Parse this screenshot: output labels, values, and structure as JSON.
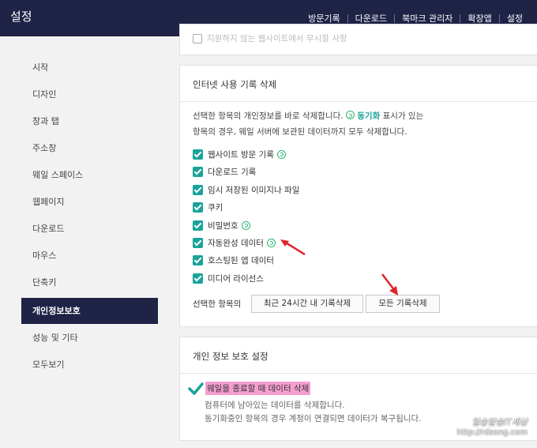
{
  "header": {
    "title": "설정",
    "nav": [
      "방문기록",
      "다운로드",
      "북마크 관리자",
      "확장앱",
      "설정"
    ]
  },
  "sidebar": {
    "items": [
      {
        "label": "시작"
      },
      {
        "label": "디자인"
      },
      {
        "label": "창과 탭"
      },
      {
        "label": "주소창"
      },
      {
        "label": "웨일 스페이스"
      },
      {
        "label": "웹페이지"
      },
      {
        "label": "다운로드"
      },
      {
        "label": "마우스"
      },
      {
        "label": "단축키"
      },
      {
        "label": "개인정보보호",
        "active": true
      },
      {
        "label": "성능 및 기타"
      },
      {
        "label": "모두보기"
      }
    ]
  },
  "top_card_partial_text": "지원하지 않는 웹사이트에서 무시할 사항",
  "history_card": {
    "title": "인터넷 사용 기록 삭제",
    "desc_line1_before": "선택한 항목의 개인정보를 바로 삭제합니다.",
    "desc_sync_label": "동기화",
    "desc_line1_after": "표시가 있는",
    "desc_line2": "항목의 경우, 웨일 서버에 보관된 데이터까지 모두 삭제합니다.",
    "items": [
      {
        "label": "웹사이트 방문 기록",
        "sync": true,
        "checked": true
      },
      {
        "label": "다운로드 기록",
        "sync": false,
        "checked": true
      },
      {
        "label": "임시 저장된 이미지나 파일",
        "sync": false,
        "checked": true
      },
      {
        "label": "쿠키",
        "sync": false,
        "checked": true
      },
      {
        "label": "비밀번호",
        "sync": true,
        "checked": true
      },
      {
        "label": "자동완성 데이터",
        "sync": true,
        "checked": true
      },
      {
        "label": "호스팅된 앱 데이터",
        "sync": false,
        "checked": true
      },
      {
        "label": "미디어 라이선스",
        "sync": false,
        "checked": true
      }
    ],
    "action_label": "선택한 항목의",
    "btn_recent": "최근 24시간 내 기록삭제",
    "btn_all": "모든 기록삭제"
  },
  "privacy_card": {
    "title": "개인 정보 보호 설정",
    "option_label": "웨일을 종료할 때 데이터 삭제",
    "option_desc1": "컴퓨터에 남아있는 데이터를 삭제합니다.",
    "option_desc2": "동기화중인 항목의 경우 계정이 연결되면 데이터가 복구됩니다."
  },
  "watermark": {
    "line1": "일송달송IT세상",
    "line2": "http://rdsong.com"
  },
  "colors": {
    "header_bg": "#1f2346",
    "accent": "#1aa39a",
    "sync_icon": "#2bb673",
    "annotation_arrow": "#e0242b",
    "highlight": "#f59ed0"
  }
}
